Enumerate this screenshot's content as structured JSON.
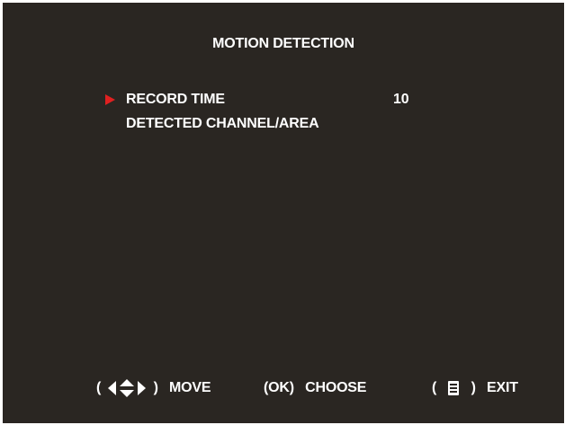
{
  "menu": {
    "title": "MOTION DETECTION",
    "items": [
      {
        "label": "RECORD TIME",
        "value": "10",
        "selected": true
      },
      {
        "label": "DETECTED CHANNEL/AREA",
        "value": "",
        "selected": false
      }
    ],
    "cursor_color": "#e02020"
  },
  "footer": {
    "move": {
      "open": "(",
      "icon": "arrow-keys-icon",
      "close": ")",
      "label": "MOVE"
    },
    "choose": {
      "key": "(OK)",
      "label": "CHOOSE"
    },
    "exit": {
      "open": "(",
      "icon": "menu-icon",
      "close": ")",
      "label": "EXIT"
    }
  },
  "colors": {
    "background": "#2a2622",
    "text": "#ffffff",
    "accent": "#e02020"
  }
}
